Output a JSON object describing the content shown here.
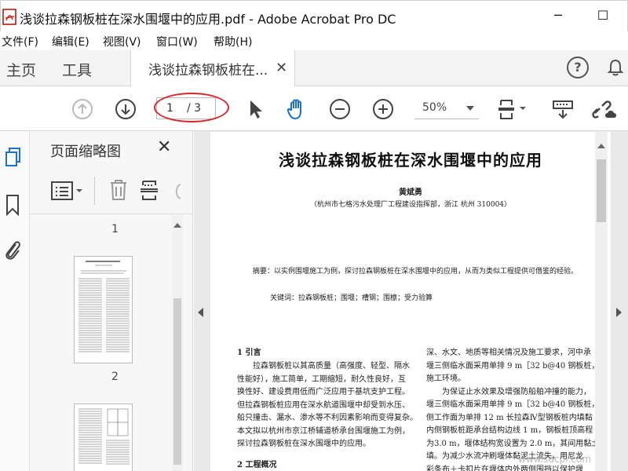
{
  "window": {
    "title": "浅谈拉森钢板桩在深水围堰中的应用.pdf - Adobe Acrobat Pro DC",
    "minimize": "─",
    "maximize": "☐"
  },
  "menu": [
    "文件(F)",
    "编辑(E)",
    "视图(V)",
    "窗口(W)",
    "帮助(H)"
  ],
  "tabs": {
    "home": "主页",
    "tools": "工具",
    "document": "浅谈拉森钢板桩在...",
    "help_icon": "?",
    "notify_icon": "bell-icon"
  },
  "toolbar": {
    "page_current": "1",
    "page_total": "/ 3",
    "zoom": "50%"
  },
  "nav_panel": {
    "title": "页面缩略图",
    "close": "✕",
    "pages": [
      "1",
      "2"
    ]
  },
  "paper": {
    "title": "浅谈拉森钢板桩在深水围堰中的应用",
    "author": "黄斌勇",
    "affiliation": "（杭州市七格污水处理厂工程建设指挥部，浙江  杭州  310004）",
    "abstract": "摘要：以实例围堰施工为例，探讨拉森钢板桩在深水围堰中的应用，从而为类似工程提供可借鉴的经验。",
    "keywords": "关键词：拉森钢板桩；围堰；槽钢；围檩；受力验算",
    "section1": "1  引言",
    "left_col": [
      "拉森钢板桩以其高质量（高强度、轻型、隔水",
      "性能好），施工简单，工期缩短，耐久性良好，互",
      "换性好、建设费用低而广泛应用于基坑支护工程。",
      "但拉森钢板桩应用在深水航道围堰中却受到水压、",
      "船只撞击、漏水、渗水等不利因素影响而变得复杂。",
      "本文拟以杭州市京江桥辅道桥承台围堰施工为例，",
      "探讨拉森钢板桩在深水围堰中的应用。"
    ],
    "section2": "2  工程概况",
    "right_col": [
      "深、水文、地质等相关情况及施工要求，河中承",
      "堰三侧临水面采用单排 9 m［32 b@40 钢板桩，",
      "侧工作面为单排 12 m 长拉森Ⅳ型钢板桩内填黏",
      "内侧钢板桩距承台结构边线 1 m，钢板桩顶高程",
      "为3.0 m，堰体结构宽设置为 2.0 m，其间用黏土",
      "填。为减少水流冲刷堰体黏泥土流失，用尼龙",
      "彩条布＋卡扣片在堰体内外两侧围挡以保护堰"
    ],
    "right_para_start": "施工环境。",
    "right_para_indent": "为保证止水效果及增强防船舶冲撞的能力，"
  },
  "watermark": "www.sdcpl.com"
}
